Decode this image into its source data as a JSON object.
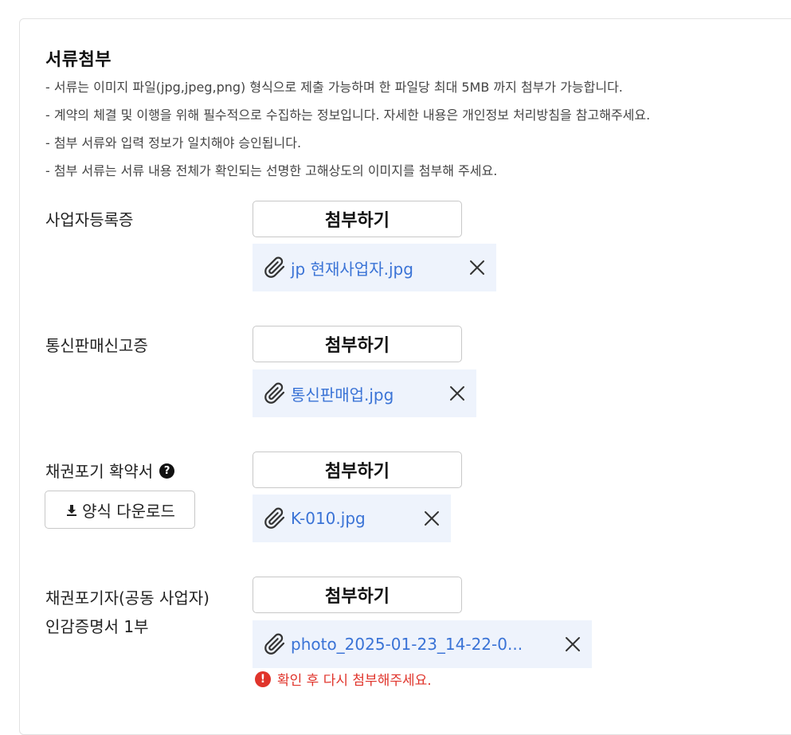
{
  "section": {
    "title": "서류첨부",
    "notes": [
      "- 서류는 이미지 파일(jpg,jpeg,png) 형식으로 제출 가능하며 한 파일당 최대 5MB 까지 첨부가 가능합니다.",
      "- 계약의 체결 및 이행을 위해 필수적으로 수집하는 정보입니다. 자세한 내용은 개인정보 처리방침을 참고해주세요.",
      "- 첨부 서류와 입력 정보가 일치해야 승인됩니다.",
      "- 첨부 서류는 서류 내용 전체가 확인되는 선명한 고해상도의 이미지를 첨부해 주세요."
    ]
  },
  "attach_label": "첨부하기",
  "rows": [
    {
      "label": "사업자등록증",
      "file": "jp 현재사업자.jpg"
    },
    {
      "label": "통신판매신고증",
      "file": "통신판매업.jpg"
    },
    {
      "label": "채권포기 확약서",
      "help": "?",
      "download_label": "양식 다운로드",
      "file": "K-010.jpg"
    },
    {
      "label_line1": "채권포기자(공동 사업자)",
      "label_line2": "인감증명서 1부",
      "file": "photo_2025-01-23_14-22-0...",
      "error": "확인 후 다시 첨부해주세요.",
      "error_icon": "!"
    }
  ],
  "icons": {
    "attachment": "paperclip-icon",
    "remove": "close-icon",
    "help": "question-circle-icon",
    "download": "download-icon",
    "error": "error-circle-icon"
  },
  "colors": {
    "link": "#3a73d6",
    "chip_bg": "#eef3fc",
    "error": "#e0342b"
  }
}
